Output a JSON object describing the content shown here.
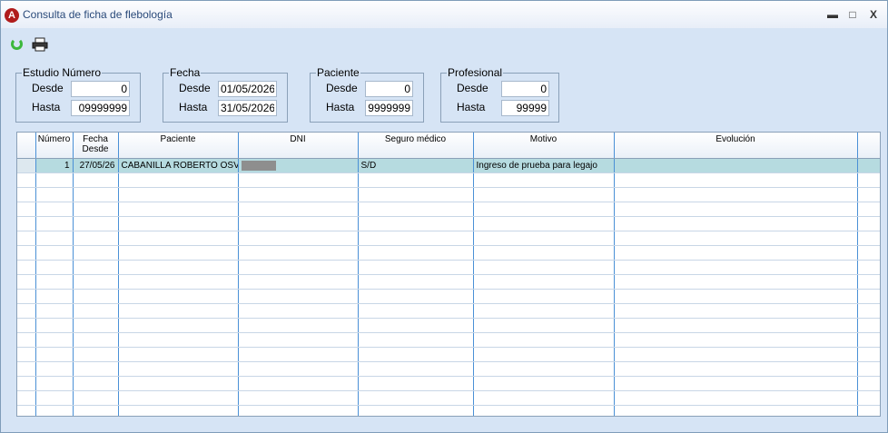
{
  "window": {
    "title": "Consulta de ficha de flebología",
    "logo_letter": "A"
  },
  "controls": {
    "minimize": "▬",
    "maximize": "□",
    "close": "X"
  },
  "toolbar": {
    "refresh_icon": "refresh-icon",
    "print_icon": "printer-icon"
  },
  "filters": {
    "estudio": {
      "legend": "Estudio Número",
      "desde_label": "Desde",
      "desde_value": "0",
      "hasta_label": "Hasta",
      "hasta_value": "09999999"
    },
    "fecha": {
      "legend": "Fecha",
      "desde_label": "Desde",
      "desde_value": "01/05/2026",
      "hasta_label": "Hasta",
      "hasta_value": "31/05/2026"
    },
    "paciente": {
      "legend": "Paciente",
      "desde_label": "Desde",
      "desde_value": "0",
      "hasta_label": "Hasta",
      "hasta_value": "9999999"
    },
    "profesional": {
      "legend": "Profesional",
      "desde_label": "Desde",
      "desde_value": "0",
      "hasta_label": "Hasta",
      "hasta_value": "99999"
    }
  },
  "table": {
    "headers": [
      "Número",
      "Fecha Desde",
      "Paciente",
      "DNI",
      "Seguro médico",
      "Motivo",
      "Evolución"
    ],
    "rows": [
      {
        "numero": "1",
        "fecha": "27/05/26",
        "paciente": "CABANILLA ROBERTO OSVA",
        "seguro": "S/D",
        "motivo": "Ingreso de prueba para legajo",
        "evolucion": ""
      }
    ]
  }
}
